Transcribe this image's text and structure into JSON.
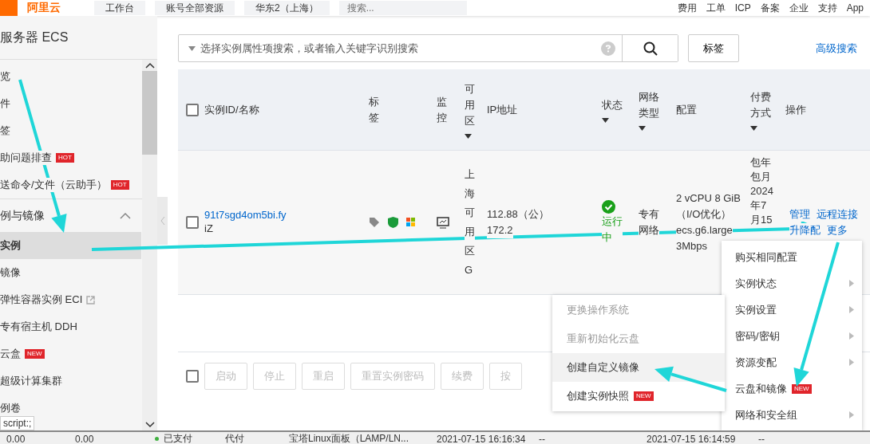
{
  "topbar": {
    "logo": "阿里云",
    "workbench": "工作台",
    "resources": "账号全部资源",
    "region": "华东2（上海）",
    "search": {
      "placeholder": "搜索..."
    },
    "links": [
      "费用",
      "工单",
      "ICP",
      "备案",
      "企业",
      "支持",
      "App"
    ]
  },
  "sidebar": {
    "title": "服务器 ECS",
    "items": [
      {
        "kind": "item",
        "label": "览",
        "selected": false
      },
      {
        "kind": "item",
        "label": "件",
        "selected": false
      },
      {
        "kind": "item",
        "label": "签",
        "selected": false
      },
      {
        "kind": "item",
        "label": "助问题排查",
        "badge": "HOT",
        "selected": false
      },
      {
        "kind": "item",
        "label": "送命令/文件（云助手）",
        "badge": "HOT",
        "selected": false
      },
      {
        "kind": "section",
        "label": "例与镜像",
        "expanded": true
      },
      {
        "kind": "item",
        "label": "实例",
        "selected": true
      },
      {
        "kind": "item",
        "label": "镜像",
        "selected": false
      },
      {
        "kind": "item",
        "label": "弹性容器实例 ECI",
        "external": true,
        "selected": false
      },
      {
        "kind": "item",
        "label": "专有宿主机 DDH",
        "selected": false
      },
      {
        "kind": "item",
        "label": "云盒",
        "badge": "NEW",
        "selected": false
      },
      {
        "kind": "item",
        "label": "超级计算集群",
        "selected": false
      },
      {
        "kind": "item",
        "label": "例卷",
        "selected": false
      }
    ],
    "tooltip": "script:;"
  },
  "search": {
    "placeholder": "选择实例属性项搜索，或者输入关键字识别搜索",
    "tag_button": "标签",
    "advanced": "高级搜索"
  },
  "table": {
    "select_all": false,
    "footer_select_all": false,
    "columns": [
      {
        "label": "实例ID/名称",
        "filter": false
      },
      {
        "label": "标签",
        "filter": false
      },
      {
        "label": "监控",
        "filter": false
      },
      {
        "label": "可用区",
        "filter": true
      },
      {
        "label": "IP地址",
        "filter": false
      },
      {
        "label": "状态",
        "filter": true
      },
      {
        "label": "网络类型",
        "filter": true
      },
      {
        "label": "配置",
        "filter": false
      },
      {
        "label": "付费方式",
        "filter": true
      },
      {
        "label": "操作",
        "filter": false
      }
    ],
    "rows": [
      {
        "selected": false,
        "id": "91t7sgd4om5bi.fy",
        "name": "iZ",
        "zone": "上海可用区G",
        "ip_public": "112.88（公）",
        "ip_private": "172.2",
        "status": "运行中",
        "network": "专有网络",
        "config": [
          "2 vCPU 8 GiB（I/O优化）",
          "ecs.g6.large",
          "3Mbps"
        ],
        "payment": "包年包月2024年7月15",
        "actions": [
          "管理",
          "远程连接",
          "升降配",
          "更多"
        ]
      }
    ],
    "footer_buttons": [
      {
        "label": "启动",
        "disabled": true
      },
      {
        "label": "停止",
        "disabled": true
      },
      {
        "label": "重启",
        "disabled": true
      },
      {
        "label": "重置实例密码",
        "disabled": true
      },
      {
        "label": "续费",
        "disabled": true
      },
      {
        "label": "按",
        "disabled": true
      }
    ]
  },
  "menu": [
    {
      "label": "购买相同配置",
      "submenu": false
    },
    {
      "label": "实例状态",
      "submenu": true
    },
    {
      "label": "实例设置",
      "submenu": true
    },
    {
      "label": "密码/密钥",
      "submenu": true
    },
    {
      "label": "资源变配",
      "submenu": true
    },
    {
      "label": "云盘和镜像",
      "badge": "NEW",
      "submenu": false
    },
    {
      "label": "网络和安全组",
      "submenu": true
    }
  ],
  "submenu": [
    {
      "label": "更换操作系统",
      "disabled": true,
      "selected": false
    },
    {
      "label": "重新初始化云盘",
      "disabled": true,
      "selected": false
    },
    {
      "label": "创建自定义镜像",
      "disabled": false,
      "selected": true
    },
    {
      "label": "创建实例快照",
      "badge": "NEW",
      "disabled": false,
      "selected": false
    }
  ],
  "background_row": [
    "0.00",
    "0.00",
    "已支付",
    "代付",
    "宝塔Linux面板（LAMP/LN...",
    "2021-07-15 16:16:34",
    "--",
    "2021-07-15 16:14:59",
    "--"
  ]
}
